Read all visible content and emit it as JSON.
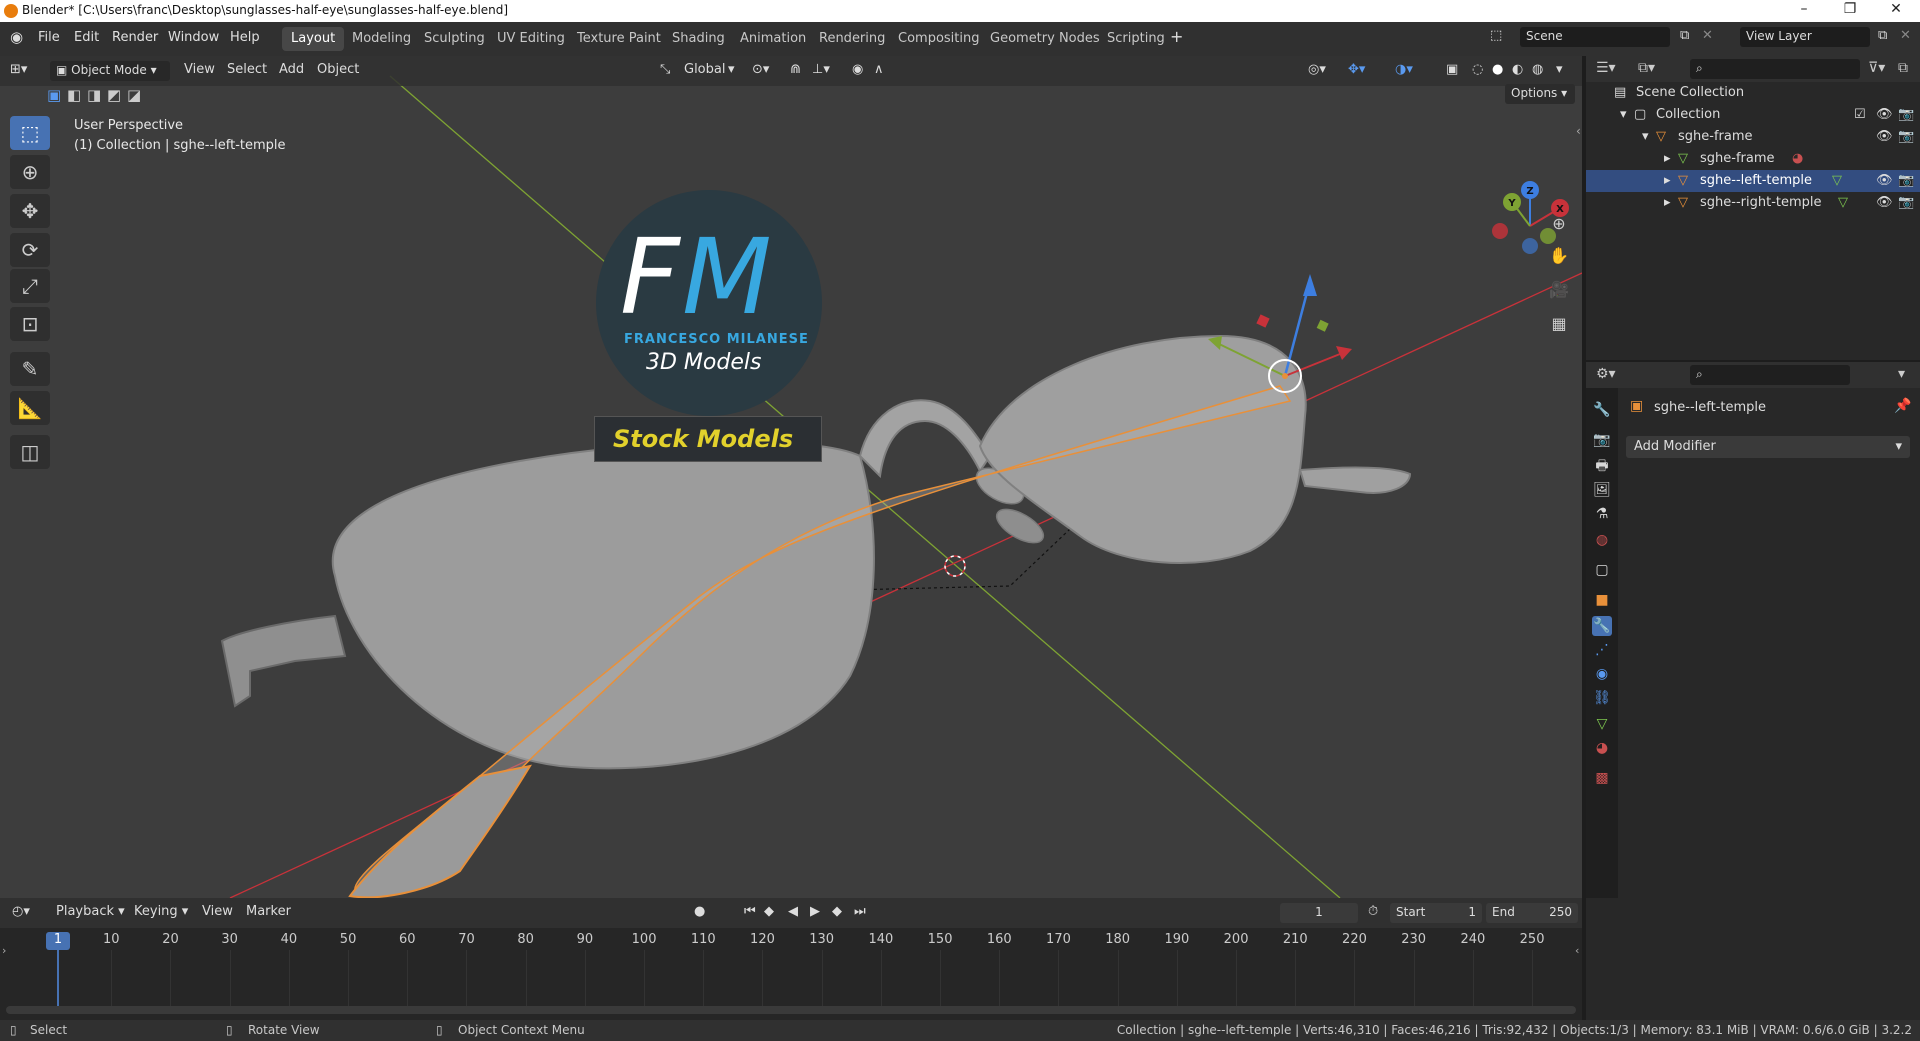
{
  "window": {
    "title": "Blender* [C:\\Users\\franc\\Desktop\\sunglasses-half-eye\\sunglasses-half-eye.blend]",
    "controls": [
      "–",
      "❐",
      "✕"
    ]
  },
  "menu": [
    "File",
    "Edit",
    "Render",
    "Window",
    "Help"
  ],
  "workspaces": [
    "Layout",
    "Modeling",
    "Sculpting",
    "UV Editing",
    "Texture Paint",
    "Shading",
    "Animation",
    "Rendering",
    "Compositing",
    "Geometry Nodes",
    "Scripting"
  ],
  "active_workspace": "Layout",
  "scene": {
    "name": "Scene",
    "view_layer": "View Layer"
  },
  "viewport_header": {
    "mode": "Object Mode",
    "menus": [
      "View",
      "Select",
      "Add",
      "Object"
    ],
    "transform_orientation": "Global",
    "options_label": "Options"
  },
  "viewport": {
    "perspective": "User Perspective",
    "context": "(1) Collection | sghe--left-temple"
  },
  "watermark": {
    "logo_letters": "FM",
    "author": "FRANCESCO MILANESE",
    "subtitle": "3D Models",
    "banner": "Stock Models"
  },
  "outliner": {
    "root": "Scene Collection",
    "items": [
      {
        "label": "Collection",
        "depth": 1
      },
      {
        "label": "sghe-frame",
        "depth": 2
      },
      {
        "label": "sghe-frame",
        "depth": 3
      },
      {
        "label": "sghe--left-temple",
        "depth": 3,
        "selected": true
      },
      {
        "label": "sghe--right-temple",
        "depth": 3
      }
    ]
  },
  "properties": {
    "object_name": "sghe--left-temple",
    "add_modifier": "Add Modifier"
  },
  "timeline": {
    "menus": [
      "Playback",
      "Keying",
      "View",
      "Marker"
    ],
    "current_frame": "1",
    "start_label": "Start",
    "start": "1",
    "end_label": "End",
    "end": "250",
    "ruler": [
      "1",
      "10",
      "20",
      "30",
      "40",
      "50",
      "60",
      "70",
      "80",
      "90",
      "100",
      "110",
      "120",
      "130",
      "140",
      "150",
      "160",
      "170",
      "180",
      "190",
      "200",
      "210",
      "220",
      "230",
      "240",
      "250"
    ]
  },
  "statusbar": {
    "select": "Select",
    "rotate": "Rotate View",
    "context_menu": "Object Context Menu",
    "stats": "Collection | sghe--left-temple | Verts:46,310 | Faces:46,216 | Tris:92,432 | Objects:1/3 | Memory: 83.1 MiB | VRAM: 0.6/6.0 GiB | 3.2.2"
  },
  "colors": {
    "accent": "#4772b3",
    "selection_outline": "#e8903a",
    "x_axis": "#c8323a",
    "y_axis": "#7ea333",
    "z_axis": "#3d7ee0",
    "watermark_banner_text": "#e2d12c",
    "watermark_blue": "#38a8e0"
  }
}
